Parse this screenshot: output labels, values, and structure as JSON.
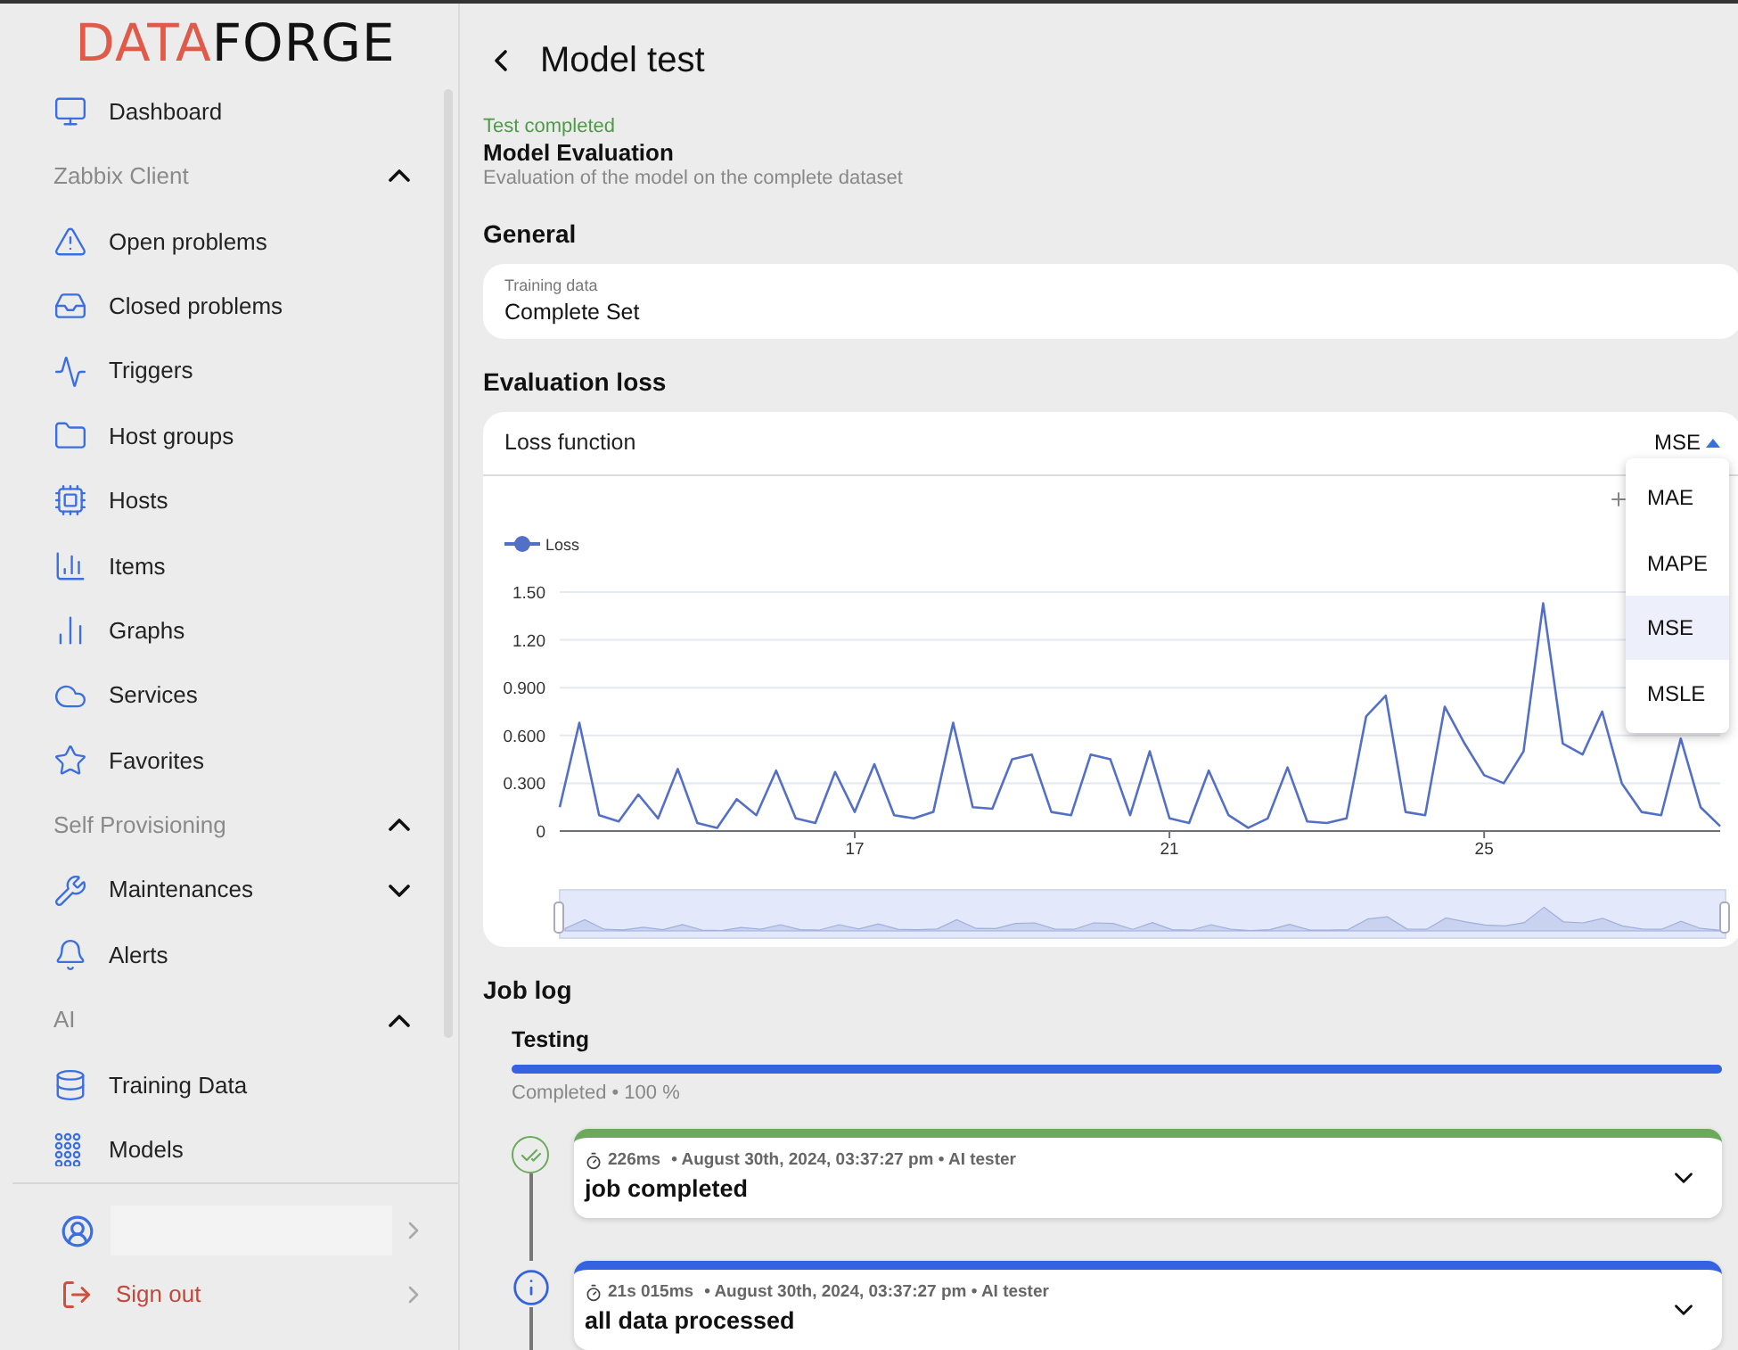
{
  "logo": {
    "part1": "DATA",
    "part2": "FORGE"
  },
  "nav": [
    {
      "kind": "item",
      "label": "Dashboard"
    },
    {
      "kind": "section",
      "label": "Zabbix Client",
      "expanded": true
    },
    {
      "kind": "item",
      "label": "Open problems"
    },
    {
      "kind": "item",
      "label": "Closed problems"
    },
    {
      "kind": "item",
      "label": "Triggers"
    },
    {
      "kind": "item",
      "label": "Host groups"
    },
    {
      "kind": "item",
      "label": "Hosts"
    },
    {
      "kind": "item",
      "label": "Items"
    },
    {
      "kind": "item",
      "label": "Graphs"
    },
    {
      "kind": "item",
      "label": "Services"
    },
    {
      "kind": "item",
      "label": "Favorites"
    },
    {
      "kind": "section",
      "label": "Self Provisioning",
      "expanded": true
    },
    {
      "kind": "group",
      "label": "Maintenances",
      "expanded": false
    },
    {
      "kind": "item",
      "label": "Alerts"
    },
    {
      "kind": "section",
      "label": "AI",
      "expanded": true
    },
    {
      "kind": "item",
      "label": "Training Data"
    },
    {
      "kind": "item",
      "label": "Models"
    }
  ],
  "sign_out": "Sign out",
  "page_title": "Model test",
  "status": "Test completed",
  "heading": "Model Evaluation",
  "subheading": "Evaluation of the model on the complete dataset",
  "general": {
    "title": "General",
    "field_label": "Training data",
    "field_value": "Complete Set"
  },
  "evaluation": {
    "title": "Evaluation loss",
    "label": "Loss function",
    "value": "MSE",
    "options": [
      {
        "label": "MAE",
        "selected": false
      },
      {
        "label": "MAPE",
        "selected": false
      },
      {
        "label": "MSE",
        "selected": true
      },
      {
        "label": "MSLE",
        "selected": false
      }
    ],
    "chart_data": {
      "type": "line",
      "grid": true,
      "ylim": [
        0,
        1.5
      ],
      "xlim": [
        13.25,
        28
      ],
      "yticks": [
        0,
        {
          "value": 0.3,
          "label": "0.300"
        },
        {
          "value": 0.6,
          "label": "0.600"
        },
        {
          "value": 0.9,
          "label": "0.900"
        },
        {
          "value": 1.2,
          "label": "1.20"
        },
        {
          "value": 1.5,
          "label": "1.50"
        }
      ],
      "xticks": [
        17,
        21,
        25
      ],
      "x": [
        13.25,
        13.5,
        13.75,
        14,
        14.25,
        14.5,
        14.75,
        15,
        15.25,
        15.5,
        15.75,
        16,
        16.25,
        16.5,
        16.75,
        17,
        17.25,
        17.5,
        17.75,
        18,
        18.25,
        18.5,
        18.75,
        19,
        19.25,
        19.5,
        19.75,
        20,
        20.25,
        20.5,
        20.75,
        21,
        21.25,
        21.5,
        21.75,
        22,
        22.25,
        22.5,
        22.75,
        23,
        23.25,
        23.5,
        23.75,
        24,
        24.25,
        24.5,
        24.75,
        25,
        25.25,
        25.5,
        25.75,
        26,
        26.25,
        26.5,
        26.75,
        27,
        27.25,
        27.5,
        27.75,
        28
      ],
      "series": [
        {
          "name": "Loss",
          "color": "#5470c6",
          "values": [
            0.15,
            0.68,
            0.1,
            0.06,
            0.23,
            0.08,
            0.39,
            0.05,
            0.02,
            0.2,
            0.1,
            0.38,
            0.08,
            0.05,
            0.37,
            0.12,
            0.42,
            0.1,
            0.08,
            0.12,
            0.68,
            0.15,
            0.14,
            0.45,
            0.48,
            0.12,
            0.1,
            0.48,
            0.45,
            0.1,
            0.5,
            0.08,
            0.05,
            0.38,
            0.1,
            0.02,
            0.08,
            0.4,
            0.06,
            0.05,
            0.08,
            0.72,
            0.85,
            0.12,
            0.1,
            0.78,
            0.55,
            0.35,
            0.3,
            0.5,
            1.43,
            0.55,
            0.48,
            0.75,
            0.3,
            0.12,
            0.1,
            0.58,
            0.15,
            0.03
          ]
        }
      ]
    }
  },
  "job_log": {
    "title": "Job log",
    "stage": "Testing",
    "level": 1,
    "progress_text": "Completed • 100 %",
    "entries": [
      {
        "kind": "success",
        "color": "#6aaa5a",
        "duration": "226ms",
        "meta": "• August 30th, 2024, 03:37:27 pm • AI tester",
        "message": "job completed"
      },
      {
        "kind": "info",
        "color": "#3462e0",
        "duration": "21s 015ms",
        "meta": "• August 30th, 2024, 03:37:27 pm • AI tester",
        "message": "all data processed"
      }
    ]
  }
}
